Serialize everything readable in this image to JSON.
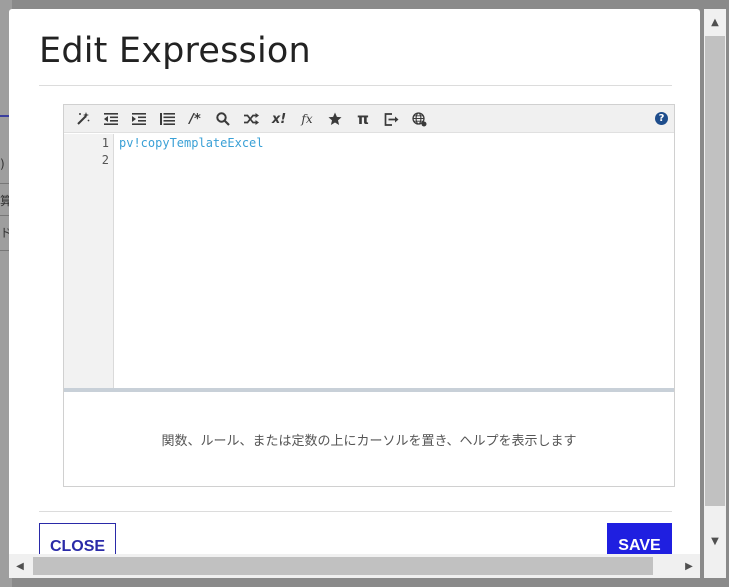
{
  "background": {
    "glyphs": [
      ")",
      "算",
      "ド"
    ]
  },
  "dialog": {
    "title": "Edit Expression",
    "close_label": "CLOSE",
    "save_label": "SAVE"
  },
  "toolbar": {
    "icons": [
      "magic-wand-icon",
      "outdent-icon",
      "indent-icon",
      "format-list-icon",
      "comment-icon",
      "search-icon",
      "shuffle-icon",
      "factorial-icon",
      "function-icon",
      "star-icon",
      "pi-icon",
      "export-icon",
      "globe-icon",
      "help-icon"
    ],
    "comment_glyph": "/*",
    "factorial_glyph": "x!",
    "function_glyph": "fx",
    "pi_glyph": "π",
    "help_glyph": "?"
  },
  "editor": {
    "lines": [
      {
        "number": "1",
        "text": "pv!copyTemplateExcel"
      },
      {
        "number": "2",
        "text": ""
      }
    ],
    "help_text": "関数、ルール、または定数の上にカーソルを置き、ヘルプを表示します"
  },
  "colors": {
    "accent": "#1f1fe0",
    "close_border": "#2a2aa8",
    "code_text": "#3aa0d6",
    "help_icon": "#1e4d8c"
  }
}
